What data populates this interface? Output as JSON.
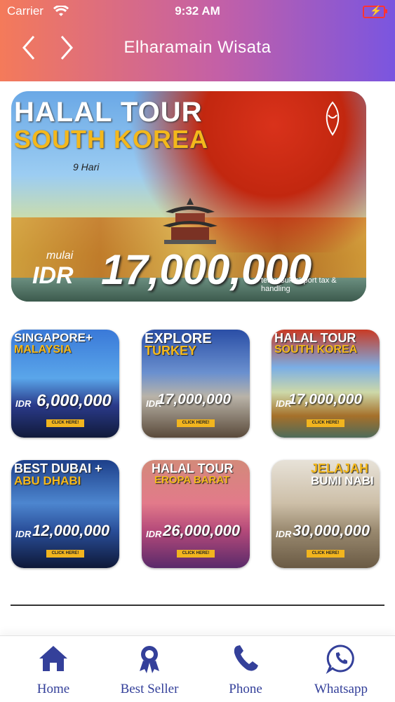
{
  "status_bar": {
    "carrier": "Carrier",
    "time": "9:32 AM"
  },
  "header": {
    "title": "Elharamain Wisata"
  },
  "banner": {
    "title_line1": "HALAL TOUR",
    "title_line2": "SOUTH KOREA",
    "duration": "9 Hari",
    "from_label": "mulai",
    "currency": "IDR",
    "price": "17,000,000",
    "note": "termasuk airport tax & handling"
  },
  "packages": [
    {
      "title_line1": "SINGAPORE+",
      "title_line2": "MALAYSIA",
      "currency": "IDR",
      "price": "6,000,000",
      "button": "CLICK HERE!"
    },
    {
      "title_line1": "EXPLORE",
      "title_line2": "TURKEY",
      "currency": "IDR",
      "price": "17,000,000",
      "button": "CLICK HERE!"
    },
    {
      "title_line1": "HALAL TOUR",
      "title_line2": "SOUTH KOREA",
      "currency": "IDR",
      "price": "17,000,000",
      "button": "CLICK HERE!"
    },
    {
      "title_line1": "BEST DUBAI +",
      "title_line2": "ABU DHABI",
      "currency": "IDR",
      "price": "12,000,000",
      "button": "CLICK HERE!"
    },
    {
      "title_line1": "HALAL TOUR",
      "title_line2": "EROPA BARAT",
      "currency": "IDR",
      "price": "26,000,000",
      "button": "CLICK HERE!"
    },
    {
      "title_line1": "JELAJAH",
      "title_line2": "BUMI NABI",
      "currency": "IDR",
      "price": "30,000,000",
      "button": "CLICK HERE!"
    }
  ],
  "tabbar": {
    "items": [
      {
        "label": "Home",
        "icon": "home-icon"
      },
      {
        "label": "Best Seller",
        "icon": "award-ribbon-icon"
      },
      {
        "label": "Phone",
        "icon": "phone-icon"
      },
      {
        "label": "Whatsapp",
        "icon": "whatsapp-icon"
      }
    ]
  },
  "colors": {
    "header_start": "#f47a5a",
    "header_end": "#7a55e0",
    "tab_icon": "#34409a",
    "price_accent": "#f3b81c"
  }
}
